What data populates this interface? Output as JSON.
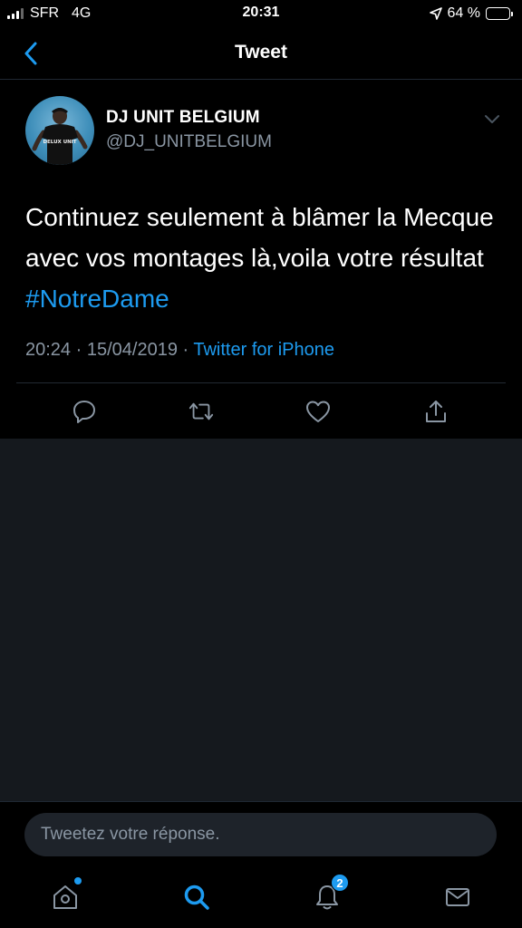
{
  "status_bar": {
    "carrier": "SFR",
    "network": "4G",
    "time": "20:31",
    "battery": "64 %",
    "battery_level": 0.64
  },
  "nav": {
    "title": "Tweet"
  },
  "tweet": {
    "display_name": "DJ UNIT BELGIUM",
    "handle": "@DJ_UNITBELGIUM",
    "text_before_hashtag": "Continuez seulement à blâmer la Mecque avec vos montages là,voila votre résultat ",
    "hashtag": "#NotreDame",
    "time": "20:24",
    "separator1": " · ",
    "date": "15/04/2019",
    "separator2": " · ",
    "source": "Twitter for iPhone",
    "avatar_shirt_text": "DELUX UNIT"
  },
  "actions": [
    "reply-icon",
    "retweet-icon",
    "like-icon",
    "share-icon"
  ],
  "reply": {
    "placeholder": "Tweetez votre réponse."
  },
  "tab_bar": {
    "notifications_badge": "2"
  },
  "colors": {
    "accent": "#1d9bf0",
    "secondary_text": "#8a96a3",
    "background": "#000000",
    "empty_area": "#15191e"
  }
}
